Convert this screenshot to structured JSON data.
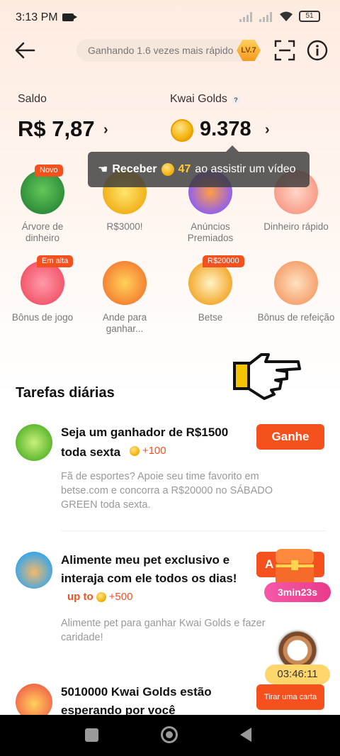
{
  "status_bar": {
    "time": "3:13 PM",
    "battery": "51"
  },
  "header": {
    "speed_text": "Ganhando 1.6 vezes mais rápido",
    "level": "LV.7"
  },
  "balance": {
    "saldo_label": "Saldo",
    "saldo_value": "R$ 7,87",
    "golds_label": "Kwai Golds",
    "golds_help": "?",
    "golds_value": "9.378"
  },
  "tooltip": {
    "prefix": "Receber",
    "amount": "47",
    "suffix": "ao assistir um vídeo"
  },
  "grid": [
    {
      "label": "Árvore de dinheiro",
      "tag": "Novo"
    },
    {
      "label": "R$3000!",
      "tag": ""
    },
    {
      "label": "Anúncios Premiados",
      "tag": ""
    },
    {
      "label": "Dinheiro rápido",
      "tag": ""
    },
    {
      "label": "Bônus de jogo",
      "tag": "Em alta"
    },
    {
      "label": "Ande para ganhar...",
      "tag": ""
    },
    {
      "label": "Betse",
      "tag": "R$20000"
    },
    {
      "label": "Bônus de refeição",
      "tag": ""
    }
  ],
  "tasks": {
    "title": "Tarefas diárias",
    "items": [
      {
        "title": "Seja um ganhador de R$1500 toda sexta",
        "reward": "+100",
        "button": "Ganhe",
        "description": "Fã de esportes? Apoie seu time favorito em betse.com e concorra a R$20000 no SÁBADO GREEN toda sexta."
      },
      {
        "title": "Alimente meu pet exclusivo e interaja com ele todos os dias!",
        "reward_prefix": "up to",
        "reward": "+500",
        "button": "A",
        "timer": "3min23s",
        "description": "Alimente pet para ganhar Kwai Golds e fazer caridade!"
      },
      {
        "title": "5010000 Kwai Golds estão esperando por você",
        "button": "Tirar uma carta",
        "food_timer": "03:46:11"
      }
    ]
  },
  "colors": {
    "accent": "#f4511e",
    "coin": "#f5b50f",
    "pink": "#e93a8c"
  }
}
